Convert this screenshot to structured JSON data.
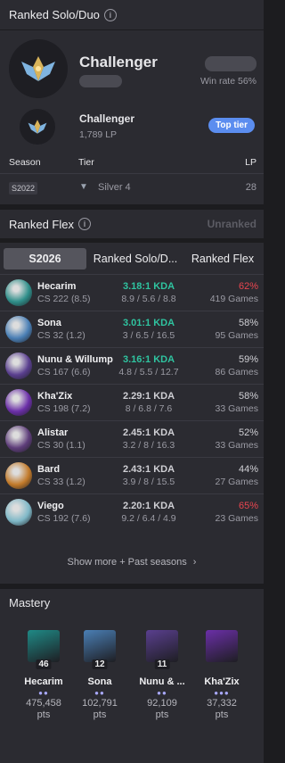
{
  "ranked_solo": {
    "title": "Ranked Solo/Duo",
    "info_glyph": "i",
    "tier": "Challenger",
    "win_rate": "Win rate 56%",
    "tier2": "Challenger",
    "lp": "1,789 LP",
    "badge": "Top tier",
    "table_headers": {
      "season": "Season",
      "tier": "Tier",
      "lp": "LP"
    },
    "past": {
      "season": "S2022",
      "tier": "Silver 4",
      "lp": "28"
    }
  },
  "ranked_flex": {
    "title": "Ranked Flex",
    "info_glyph": "i",
    "status": "Unranked"
  },
  "tabs": [
    "S2026",
    "Ranked Solo/D...",
    "Ranked Flex"
  ],
  "champions": [
    {
      "name": "Hecarim",
      "cs": "CS 222 (8.5)",
      "kda": "3.18:1 KDA",
      "kda_detail": "8.9 / 5.6 / 8.8",
      "wr": "62%",
      "games": "419 Games",
      "color": "#2f8f8a"
    },
    {
      "name": "Sona",
      "cs": "CS 32 (1.2)",
      "kda": "3.01:1 KDA",
      "kda_detail": "3 / 6.5 / 16.5",
      "wr": "58%",
      "games": "95 Games",
      "color": "#4a7fb5"
    },
    {
      "name": "Nunu & Willump",
      "cs": "CS 167 (6.6)",
      "kda": "3.16:1 KDA",
      "kda_detail": "4.8 / 5.5 / 12.7",
      "wr": "59%",
      "games": "86 Games",
      "color": "#5a3f8f"
    },
    {
      "name": "Kha'Zix",
      "cs": "CS 198 (7.2)",
      "kda": "2.29:1 KDA",
      "kda_detail": "8 / 6.8 / 7.6",
      "wr": "58%",
      "games": "33 Games",
      "color": "#6b2fa8"
    },
    {
      "name": "Alistar",
      "cs": "CS 30 (1.1)",
      "kda": "2.45:1 KDA",
      "kda_detail": "3.2 / 8 / 16.3",
      "wr": "52%",
      "games": "33 Games",
      "color": "#5e3d7a"
    },
    {
      "name": "Bard",
      "cs": "CS 33 (1.2)",
      "kda": "2.43:1 KDA",
      "kda_detail": "3.9 / 8 / 15.5",
      "wr": "44%",
      "games": "27 Games",
      "color": "#c27a2a"
    },
    {
      "name": "Viego",
      "cs": "CS 192 (7.6)",
      "kda": "2.20:1 KDA",
      "kda_detail": "9.2 / 6.4 / 4.9",
      "wr": "65%",
      "games": "23 Games",
      "color": "#7fb8c7"
    }
  ],
  "show_more": "Show more + Past seasons",
  "mastery": {
    "title": "Mastery",
    "items": [
      {
        "name": "Hecarim",
        "level": "46",
        "pts": "475,458",
        "unit": "pts",
        "dots": "●●",
        "color": "#1f8a86"
      },
      {
        "name": "Sona",
        "level": "12",
        "pts": "102,791",
        "unit": "pts",
        "dots": "●●",
        "color": "#4a7fb5"
      },
      {
        "name": "Nunu & ...",
        "level": "11",
        "pts": "92,109",
        "unit": "pts",
        "dots": "●●",
        "color": "#5a3f8f"
      },
      {
        "name": "Kha'Zix",
        "level": "",
        "pts": "37,332",
        "unit": "pts",
        "dots": "●●●",
        "color": "#6b2fa8"
      }
    ]
  }
}
